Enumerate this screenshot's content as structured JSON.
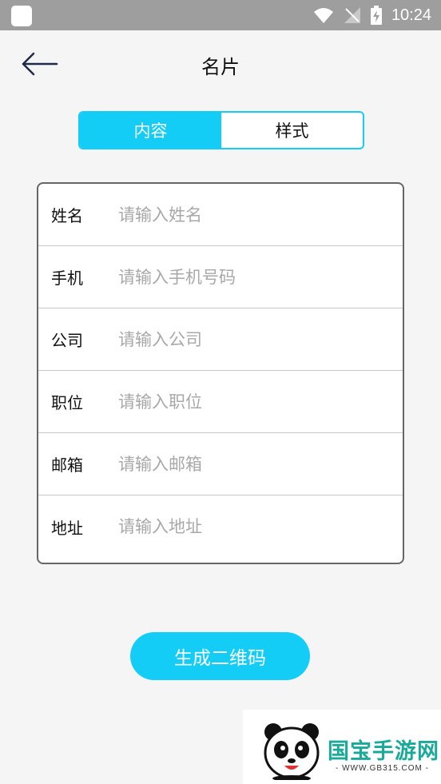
{
  "status_bar": {
    "time": "10:24"
  },
  "header": {
    "title": "名片"
  },
  "tabs": [
    {
      "label": "内容",
      "active": true
    },
    {
      "label": "样式",
      "active": false
    }
  ],
  "form": {
    "fields": [
      {
        "label": "姓名",
        "placeholder": "请输入姓名",
        "value": ""
      },
      {
        "label": "手机",
        "placeholder": "请输入手机号码",
        "value": ""
      },
      {
        "label": "公司",
        "placeholder": "请输入公司",
        "value": ""
      },
      {
        "label": "职位",
        "placeholder": "请输入职位",
        "value": ""
      },
      {
        "label": "邮箱",
        "placeholder": "请输入邮箱",
        "value": ""
      },
      {
        "label": "地址",
        "placeholder": "请输入地址",
        "value": ""
      }
    ]
  },
  "generate_button": {
    "label": "生成二维码"
  },
  "watermark": {
    "brand": "国宝手游网",
    "url": "- WWW.GB315.COM -"
  },
  "colors": {
    "accent": "#13cdf7",
    "status_bar": "#9e9e9e",
    "background": "#f5f5f5"
  }
}
